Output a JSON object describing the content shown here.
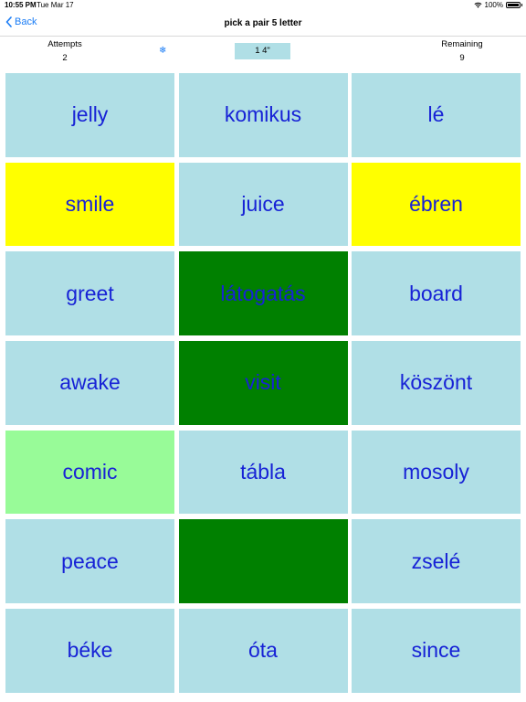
{
  "status_bar": {
    "time": "10:55 PM",
    "date": "Tue Mar 17",
    "battery": "100%"
  },
  "nav": {
    "back_label": "Back",
    "title": "pick a pair 5 letter"
  },
  "stats": {
    "attempts_label": "Attempts",
    "attempts_value": "2",
    "timer": "1 4\"",
    "remaining_label": "Remaining",
    "remaining_value": "9"
  },
  "cards": [
    {
      "text": "jelly",
      "state": "default"
    },
    {
      "text": "komikus",
      "state": "default"
    },
    {
      "text": "lé",
      "state": "default"
    },
    {
      "text": "smile",
      "state": "selected"
    },
    {
      "text": "juice",
      "state": "default"
    },
    {
      "text": "ébren",
      "state": "selected"
    },
    {
      "text": "greet",
      "state": "default"
    },
    {
      "text": "látogatás",
      "state": "matched"
    },
    {
      "text": "board",
      "state": "default"
    },
    {
      "text": "awake",
      "state": "default"
    },
    {
      "text": "visit",
      "state": "matched"
    },
    {
      "text": "köszönt",
      "state": "default"
    },
    {
      "text": "comic",
      "state": "partial"
    },
    {
      "text": "tábla",
      "state": "default"
    },
    {
      "text": "mosoly",
      "state": "default"
    },
    {
      "text": "peace",
      "state": "default"
    },
    {
      "text": "",
      "state": "matched"
    },
    {
      "text": "zselé",
      "state": "default"
    },
    {
      "text": "béke",
      "state": "default"
    },
    {
      "text": "óta",
      "state": "default"
    },
    {
      "text": "since",
      "state": "default"
    }
  ],
  "colors": {
    "card_default": "#b0dfe6",
    "card_selected": "#ffff00",
    "card_matched": "#008000",
    "card_partial": "#98fb98",
    "card_text": "#1722d6",
    "accent": "#1a7cf5"
  }
}
